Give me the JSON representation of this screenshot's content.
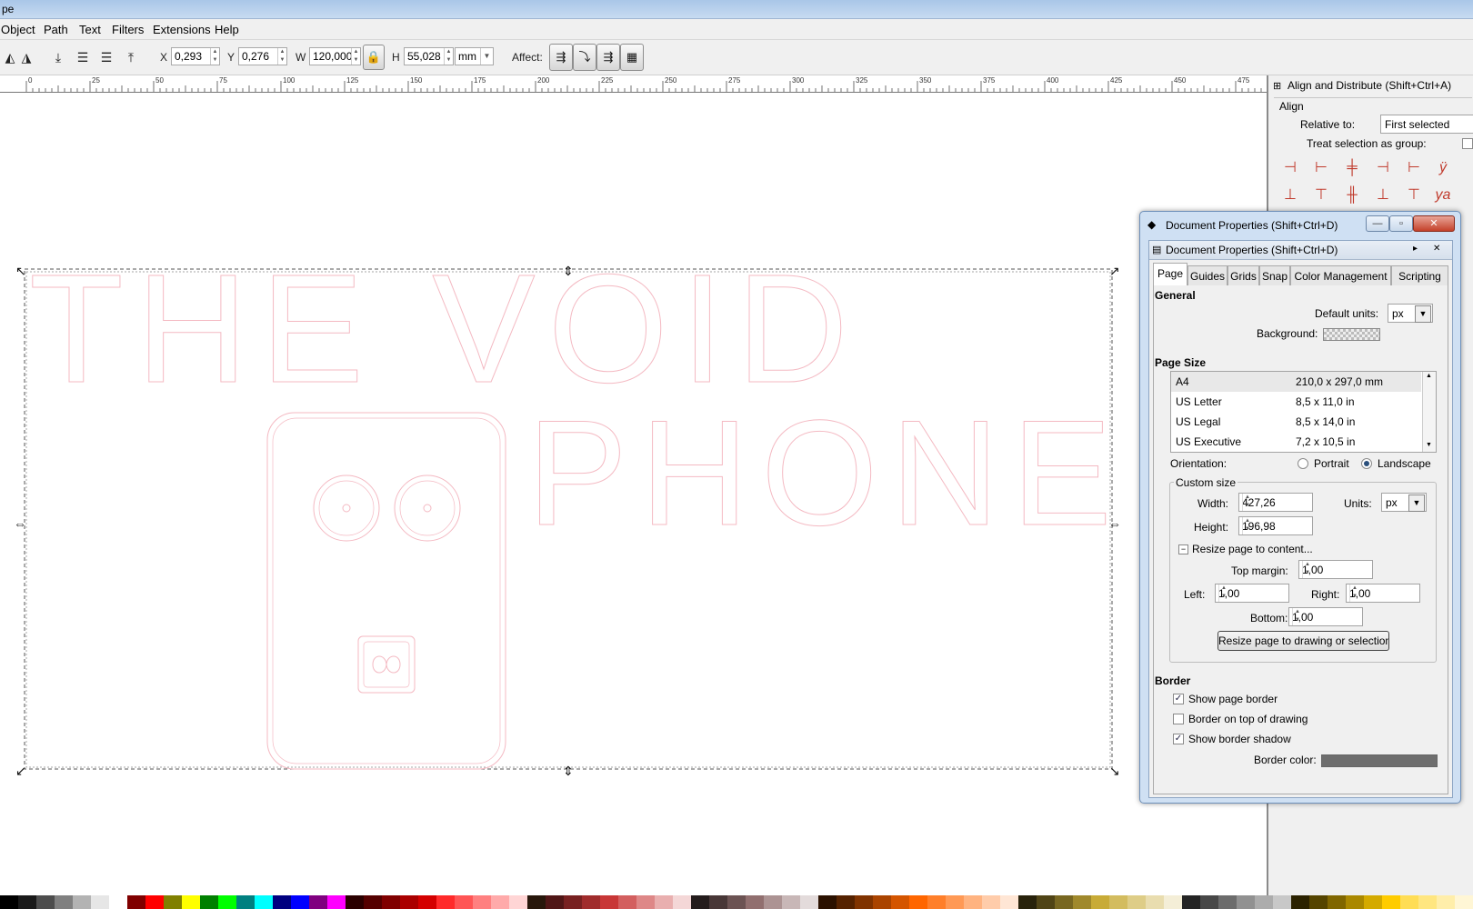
{
  "window": {
    "title_fragment": "pe"
  },
  "menu": [
    "Object",
    "Path",
    "Text",
    "Filters",
    "Extensions",
    "Help"
  ],
  "toolbar": {
    "x_label": "X",
    "x_value": "0,293",
    "y_label": "Y",
    "y_value": "0,276",
    "w_label": "W",
    "w_value": "120,000",
    "h_label": "H",
    "h_value": "55,028",
    "unit": "mm",
    "affect_label": "Affect:"
  },
  "ruler_labels": [
    "0",
    "25",
    "50",
    "75",
    "100",
    "125",
    "150",
    "175",
    "200",
    "225",
    "250",
    "275",
    "300",
    "325",
    "350",
    "375",
    "400",
    "425",
    "450",
    "475"
  ],
  "canvas": {
    "title_line1": "THE VOID",
    "title_line2": "PHONE",
    "outline_color": "#f2b8c0"
  },
  "align_panel": {
    "title": "Align and Distribute (Shift+Ctrl+A)",
    "section": "Align",
    "relative_label": "Relative to:",
    "relative_value": "First selected",
    "treat_group_label": "Treat selection as group:"
  },
  "doc_window": {
    "title": "Document Properties (Shift+Ctrl+D)",
    "inner_title": "Document Properties (Shift+Ctrl+D)",
    "tabs": [
      "Page",
      "Guides",
      "Grids",
      "Snap",
      "Color Management",
      "Scripting"
    ],
    "general": {
      "header": "General",
      "default_units_label": "Default units:",
      "default_units_value": "px",
      "background_label": "Background:"
    },
    "page_size": {
      "header": "Page Size",
      "rows": [
        {
          "name": "A4",
          "size": "210,0 x 297,0 mm"
        },
        {
          "name": "US Letter",
          "size": "8,5 x 11,0 in"
        },
        {
          "name": "US Legal",
          "size": "8,5 x 14,0 in"
        },
        {
          "name": "US Executive",
          "size": "7,2 x 10,5 in"
        }
      ],
      "orientation_label": "Orientation:",
      "portrait_label": "Portrait",
      "landscape_label": "Landscape"
    },
    "custom": {
      "header": "Custom size",
      "width_label": "Width:",
      "width_value": "427,26",
      "height_label": "Height:",
      "height_value": "196,98",
      "units_label": "Units:",
      "units_value": "px",
      "resize_label": "Resize page to content...",
      "top_label": "Top margin:",
      "top_value": "1,00",
      "left_label": "Left:",
      "left_value": "1,00",
      "right_label": "Right:",
      "right_value": "1,00",
      "bottom_label": "Bottom:",
      "bottom_value": "1,00",
      "resize_button": "Resize page to drawing or selection"
    },
    "border": {
      "header": "Border",
      "show_border": "Show page border",
      "on_top": "Border on top of drawing",
      "shadow": "Show border shadow",
      "color_label": "Border color:",
      "color_value": "#6e6e6e"
    }
  },
  "palette": [
    "#000000",
    "#1a1a1a",
    "#4d4d4d",
    "#808080",
    "#b3b3b3",
    "#e6e6e6",
    "#ffffff",
    "#800000",
    "#ff0000",
    "#808000",
    "#ffff00",
    "#008000",
    "#00ff00",
    "#008080",
    "#00ffff",
    "#000080",
    "#0000ff",
    "#800080",
    "#ff00ff",
    "#2b0000",
    "#550000",
    "#800000",
    "#aa0000",
    "#d40000",
    "#ff2a2a",
    "#ff5555",
    "#ff8080",
    "#ffaaaa",
    "#ffd5d5",
    "#28170b",
    "#501616",
    "#782121",
    "#a02c2c",
    "#c83737",
    "#d35f5f",
    "#de8787",
    "#e9afaf",
    "#f4d7d7",
    "#241c1c",
    "#483737",
    "#6c5353",
    "#916f6f",
    "#ac9393",
    "#c8b7b7",
    "#e3dbdb",
    "#2b1100",
    "#552200",
    "#803300",
    "#aa4400",
    "#d45500",
    "#ff6600",
    "#ff7f2a",
    "#ff9955",
    "#ffb380",
    "#ffccaa",
    "#ffe6d5",
    "#28220b",
    "#504416",
    "#786721",
    "#a0892c",
    "#c8ab37",
    "#d3bc5f",
    "#decd87",
    "#e9ddaf",
    "#f4eed7",
    "#242424",
    "#484848",
    "#6c6c6c",
    "#919191",
    "#acacac",
    "#c8c8c8",
    "#2b2200",
    "#554400",
    "#806600",
    "#aa8800",
    "#d4aa00",
    "#ffcc00",
    "#ffdd55",
    "#ffe680",
    "#ffeeaa",
    "#fff6d5"
  ]
}
